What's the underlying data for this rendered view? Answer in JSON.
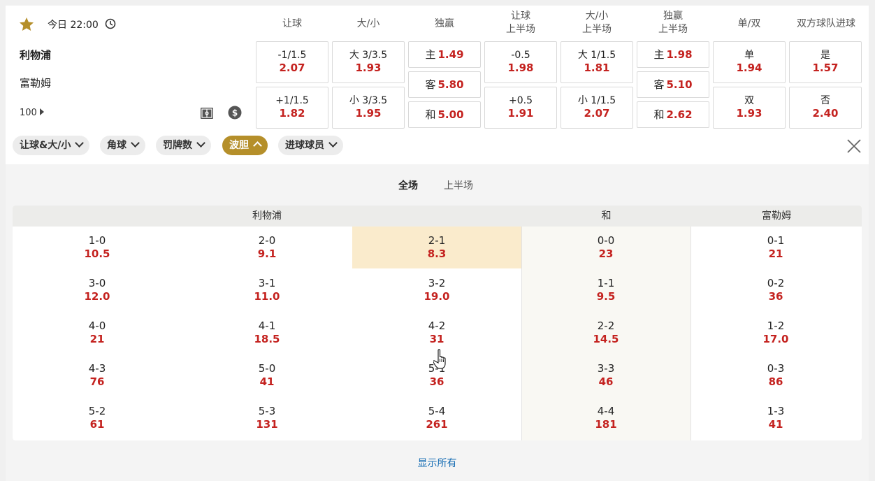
{
  "match": {
    "time": "今日 22:00",
    "home": "利物浦",
    "away": "富勒姆",
    "more_markets": "100"
  },
  "colors": {
    "accent": "#b58f2a",
    "odds": "#c4221f",
    "link": "#1a6fb5",
    "highlight": "#faebcc"
  },
  "columns": [
    {
      "label1": "让球",
      "label2": ""
    },
    {
      "label1": "大/小",
      "label2": ""
    },
    {
      "label1": "独赢",
      "label2": ""
    },
    {
      "label1": "让球",
      "label2": "上半场"
    },
    {
      "label1": "大/小",
      "label2": "上半场"
    },
    {
      "label1": "独赢",
      "label2": "上半场"
    },
    {
      "label1": "单/双",
      "label2": ""
    },
    {
      "label1": "双方球队进球",
      "label2": ""
    }
  ],
  "odds": {
    "handicap": [
      {
        "label": "-1/1.5",
        "odd": "2.07"
      },
      {
        "label": "+1/1.5",
        "odd": "1.82"
      }
    ],
    "overunder": [
      {
        "label": "大 3/3.5",
        "odd": "1.93"
      },
      {
        "label": "小 3/3.5",
        "odd": "1.95"
      }
    ],
    "moneyline": [
      {
        "label": "主",
        "odd": "1.49"
      },
      {
        "label": "客",
        "odd": "5.80"
      },
      {
        "label": "和",
        "odd": "5.00"
      }
    ],
    "handicap_ht": [
      {
        "label": "-0.5",
        "odd": "1.98"
      },
      {
        "label": "+0.5",
        "odd": "1.91"
      }
    ],
    "overunder_ht": [
      {
        "label": "大 1/1.5",
        "odd": "1.81"
      },
      {
        "label": "小 1/1.5",
        "odd": "2.07"
      }
    ],
    "moneyline_ht": [
      {
        "label": "主",
        "odd": "1.98"
      },
      {
        "label": "客",
        "odd": "5.10"
      },
      {
        "label": "和",
        "odd": "2.62"
      }
    ],
    "oddeven": [
      {
        "label": "单",
        "odd": "1.94"
      },
      {
        "label": "双",
        "odd": "1.93"
      }
    ],
    "btts": [
      {
        "label": "是",
        "odd": "1.57"
      },
      {
        "label": "否",
        "odd": "2.40"
      }
    ]
  },
  "filters": [
    {
      "label": "让球&大/小",
      "active": false
    },
    {
      "label": "角球",
      "active": false
    },
    {
      "label": "罚牌数",
      "active": false
    },
    {
      "label": "波胆",
      "active": true
    },
    {
      "label": "进球球员",
      "active": false
    }
  ],
  "period_tabs": [
    {
      "label": "全场",
      "active": true
    },
    {
      "label": "上半场",
      "active": false
    }
  ],
  "correct_score": {
    "headers": {
      "home": "利物浦",
      "draw": "和",
      "away": "富勒姆"
    },
    "rows": [
      [
        {
          "score": "1-0",
          "odd": "10.5"
        },
        {
          "score": "2-0",
          "odd": "9.1"
        },
        {
          "score": "2-1",
          "odd": "8.3",
          "selected": true
        },
        {
          "score": "0-0",
          "odd": "23"
        },
        {
          "score": "0-1",
          "odd": "21"
        }
      ],
      [
        {
          "score": "3-0",
          "odd": "12.0"
        },
        {
          "score": "3-1",
          "odd": "11.0"
        },
        {
          "score": "3-2",
          "odd": "19.0"
        },
        {
          "score": "1-1",
          "odd": "9.5"
        },
        {
          "score": "0-2",
          "odd": "36"
        }
      ],
      [
        {
          "score": "4-0",
          "odd": "21"
        },
        {
          "score": "4-1",
          "odd": "18.5"
        },
        {
          "score": "4-2",
          "odd": "31"
        },
        {
          "score": "2-2",
          "odd": "14.5"
        },
        {
          "score": "1-2",
          "odd": "17.0"
        }
      ],
      [
        {
          "score": "4-3",
          "odd": "76"
        },
        {
          "score": "5-0",
          "odd": "41"
        },
        {
          "score": "5-1",
          "odd": "36"
        },
        {
          "score": "3-3",
          "odd": "46"
        },
        {
          "score": "0-3",
          "odd": "86"
        }
      ],
      [
        {
          "score": "5-2",
          "odd": "61"
        },
        {
          "score": "5-3",
          "odd": "131"
        },
        {
          "score": "5-4",
          "odd": "261"
        },
        {
          "score": "4-4",
          "odd": "181"
        },
        {
          "score": "1-3",
          "odd": "41"
        }
      ]
    ]
  },
  "show_all": "显示所有"
}
